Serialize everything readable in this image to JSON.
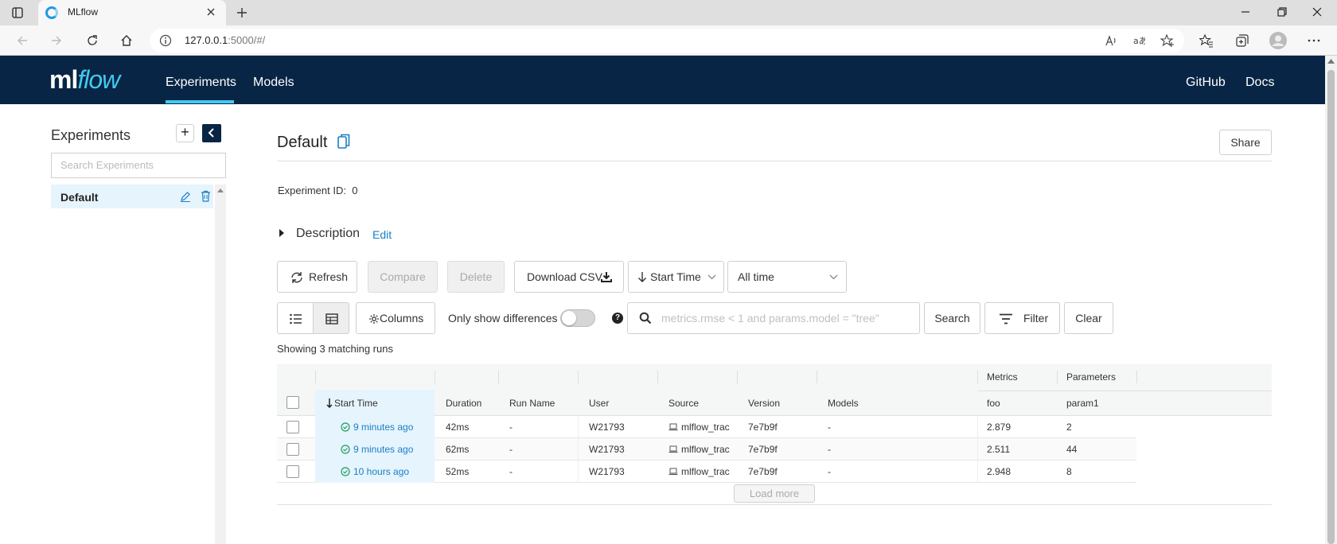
{
  "browser": {
    "tab_title": "MLflow",
    "url_host": "127.0.0.1",
    "url_rest": ":5000/#/"
  },
  "nav": {
    "logo_a": "ml",
    "logo_b": "flow",
    "experiments": "Experiments",
    "models": "Models",
    "github": "GitHub",
    "docs": "Docs"
  },
  "sidebar": {
    "title": "Experiments",
    "add_label": "+",
    "search_placeholder": "Search Experiments",
    "items": [
      {
        "label": "Default"
      }
    ]
  },
  "experiment": {
    "name": "Default",
    "share": "Share",
    "id_label": "Experiment ID:",
    "id_value": "0",
    "description": "Description",
    "edit": "Edit"
  },
  "toolbar": {
    "refresh": "Refresh",
    "compare": "Compare",
    "delete": "Delete",
    "download_csv": "Download CSV",
    "sort": "Start Time",
    "time_range": "All time",
    "columns": "Columns",
    "only_diff": "Only show differences",
    "help": "?",
    "search_placeholder": "metrics.rmse < 1 and params.model = \"tree\"",
    "search": "Search",
    "filter": "Filter",
    "clear": "Clear"
  },
  "runs": {
    "summary": "Showing 3 matching runs",
    "group_metrics": "Metrics",
    "group_parameters": "Parameters",
    "columns": [
      "Start Time",
      "Duration",
      "Run Name",
      "User",
      "Source",
      "Version",
      "Models",
      "foo",
      "param1"
    ],
    "rows": [
      {
        "start_time": "9 minutes ago",
        "duration": "42ms",
        "run_name": "-",
        "user": "W21793",
        "source": "mlflow_trac",
        "version": "7e7b9f",
        "models": "-",
        "foo": "2.879",
        "param1": "2"
      },
      {
        "start_time": "9 minutes ago",
        "duration": "62ms",
        "run_name": "-",
        "user": "W21793",
        "source": "mlflow_trac",
        "version": "7e7b9f",
        "models": "-",
        "foo": "2.511",
        "param1": "44"
      },
      {
        "start_time": "10 hours ago",
        "duration": "52ms",
        "run_name": "-",
        "user": "W21793",
        "source": "mlflow_trac",
        "version": "7e7b9f",
        "models": "-",
        "foo": "2.948",
        "param1": "8"
      }
    ],
    "load_more": "Load more"
  },
  "colors": {
    "nav_bg": "#082545",
    "accent": "#43c9ed",
    "link": "#1a7fc5",
    "selected_bg": "#e6f4fd"
  }
}
